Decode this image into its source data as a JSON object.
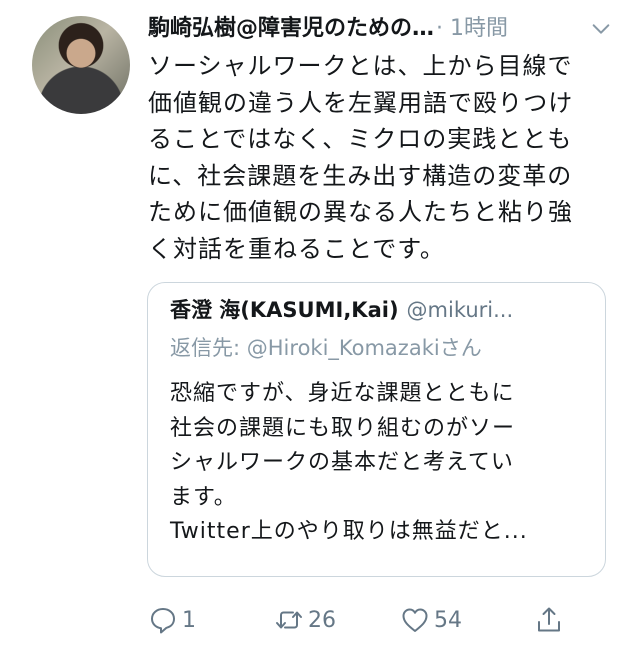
{
  "tweet": {
    "author_name": "駒崎弘樹@障害児のための…",
    "time": "· 1時間",
    "lines": [
      "ソーシャルワークとは、上から目線で",
      "価値観の違う人を左翼用語で殴りつけ",
      "ることではなく、ミクロの実践ととも",
      "に、社会課題を生み出す構造の変革の",
      "ために価値観の異なる人たちと粘り強",
      "く対話を重ねることです。"
    ]
  },
  "quote": {
    "author_name": "香澄 海(KASUMI,Kai)",
    "handle": "@mikuri...",
    "reply_prefix": "返信先: ",
    "reply_mention": "@Hiroki_Komazaki",
    "reply_suffix": "さん",
    "lines": [
      "恐縮ですが、身近な課題とともに",
      "社会の課題にも取り組むのがソー",
      "シャルワークの基本だと考えてい",
      "ます。",
      "Twitter上のやり取りは無益だと..."
    ]
  },
  "actions": {
    "replies": "1",
    "retweets": "26",
    "likes": "54"
  },
  "icons": {
    "reply": "speech-bubble-icon",
    "retweet": "retweet-icon",
    "like": "heart-icon",
    "share": "share-icon",
    "menu": "chevron-down-icon"
  },
  "colors": {
    "text": "#14171a",
    "muted": "#657786",
    "light_muted": "#8899a6",
    "border": "#ccd6dd"
  }
}
